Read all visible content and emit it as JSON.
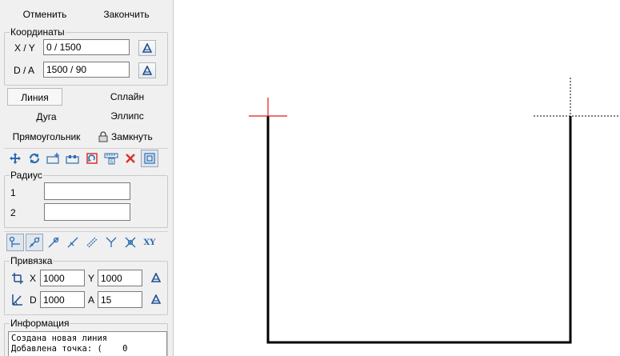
{
  "header": {
    "cancel_label": "Отменить",
    "finish_label": "Закончить"
  },
  "coords": {
    "title": "Координаты",
    "xy_label": "X / Y",
    "xy_value": "0 / 1500",
    "da_label": "D / A",
    "da_value": "1500 / 90"
  },
  "modes": {
    "line": "Линия",
    "spline": "Сплайн",
    "arc": "Дуга",
    "ellipse": "Эллипс",
    "rectangle": "Прямоугольник",
    "close": "Замкнуть",
    "active": "line"
  },
  "toolbar1": [
    "move-icon",
    "rotate-icon",
    "insert-point-icon",
    "add-segment-icon",
    "mirror-icon",
    "measure-ruler-icon",
    "delete-icon",
    "view-toggle-icon"
  ],
  "radius": {
    "title": "Радиус",
    "r1_label": "1",
    "r1_value": "",
    "r2_label": "2",
    "r2_value": ""
  },
  "toolbar2": [
    "snap-endpoint-icon",
    "snap-line-icon",
    "snap-point-icon",
    "snap-on-line-icon",
    "snap-parallel-icon",
    "snap-perpendicular-icon",
    "snap-intersection-icon",
    "snap-xy-icon"
  ],
  "toolbar2_xy_text": "XY",
  "snap": {
    "title": "Привязка",
    "x_label": "X",
    "x_value": "1000",
    "y_label": "Y",
    "y_value": "1000",
    "d_label": "D",
    "d_value": "1000",
    "a_label": "A",
    "a_value": "15"
  },
  "info": {
    "title": "Информация",
    "text": "Создана новая линия\nДобавлена точка: (    0"
  },
  "colors": {
    "cursor": "#e0191b",
    "drawn_line": "#000000",
    "panel_bg": "#f0f0f0",
    "icon_blue": "#2b6cb0",
    "icon_red": "#d9302c"
  }
}
